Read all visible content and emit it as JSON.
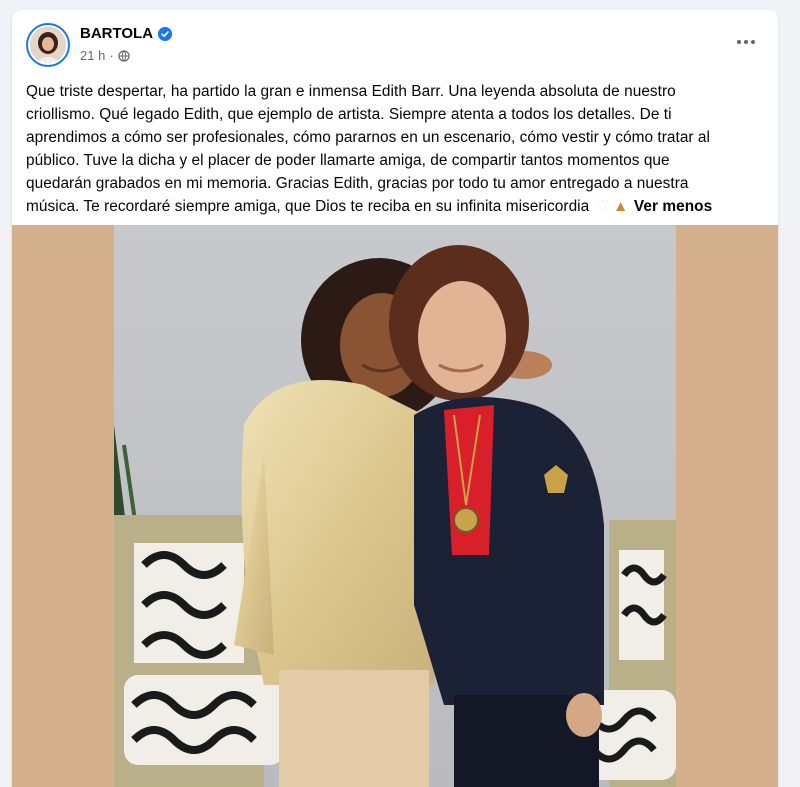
{
  "post": {
    "author": "BARTOLA",
    "time": "21 h",
    "separator": "·",
    "verified": true,
    "text_lines": [
      "Que triste despertar, ha partido la gran e inmensa Edith Barr. Una leyenda absoluta de nuestro",
      "criollismo. Qué legado Edith, que ejemplo de artista. Siempre atenta a todos los detalles. De ti",
      "aprendimos a cómo ser profesionales, cómo pararnos en un escenario, cómo vestir y cómo tratar al",
      "público. Tuve la dicha y el placer de poder llamarte amiga, de compartir tantos momentos que",
      "quedarán grabados en mi memoria. Gracias Edith, gracias por todo tu amor entregado a nuestra",
      "música. Te recordaré siempre amiga, que Dios te reciba en su infinita misericordia"
    ],
    "see_less": "Ver menos",
    "emojis": [
      "white-heart",
      "folded-hands"
    ]
  },
  "colors": {
    "accent": "#1877f2",
    "background": "#f0f2f5",
    "muted_text": "#65676b",
    "media_backdrop": "#d4b08c"
  },
  "icons": {
    "verified": "verified-badge-icon",
    "privacy": "globe-icon",
    "more": "more-options-icon"
  }
}
